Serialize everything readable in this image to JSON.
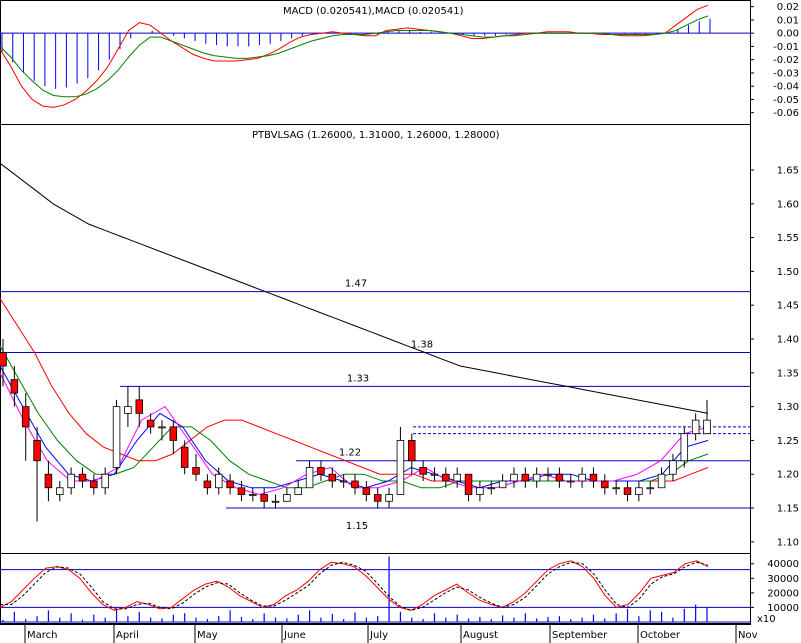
{
  "chart_data": [
    {
      "id": "macd",
      "type": "line",
      "title": "MACD (0.020541),MACD (0.020541)",
      "ylim": [
        -0.067,
        0.022
      ],
      "yticks": [
        "0.02",
        "0.01",
        "0.00",
        "-0.01",
        "-0.02",
        "-0.03",
        "-0.04",
        "-0.05",
        "-0.06"
      ],
      "ytick_values": [
        0.02,
        0.01,
        0.0,
        -0.01,
        -0.02,
        -0.03,
        -0.04,
        -0.05,
        -0.06
      ],
      "series": [
        {
          "color": "#ff0000",
          "values": [
            -0.012,
            -0.025,
            -0.04,
            -0.05,
            -0.055,
            -0.056,
            -0.054,
            -0.05,
            -0.044,
            -0.036,
            -0.026,
            -0.012,
            0.002,
            0.008,
            0.006,
            0.0,
            -0.006,
            -0.011,
            -0.016,
            -0.019,
            -0.021,
            -0.021,
            -0.021,
            -0.02,
            -0.019,
            -0.016,
            -0.012,
            -0.007,
            -0.003,
            -0.001,
            0.0,
            0.001,
            0.0,
            -0.001,
            -0.002,
            -0.002,
            0.002,
            0.003,
            0.004,
            0.003,
            0.002,
            0.001,
            0.0,
            -0.002,
            -0.004,
            -0.004,
            -0.003,
            -0.002,
            -0.001,
            0.0,
            0.0,
            0.001,
            0.001,
            0.001,
            0.0,
            0.0,
            -0.001,
            -0.001,
            -0.002,
            -0.002,
            -0.002,
            -0.001,
            0.0,
            0.006,
            0.012,
            0.018,
            0.021
          ]
        },
        {
          "color": "#008000",
          "values": [
            -0.01,
            -0.018,
            -0.028,
            -0.036,
            -0.043,
            -0.047,
            -0.048,
            -0.048,
            -0.046,
            -0.042,
            -0.036,
            -0.028,
            -0.018,
            -0.009,
            -0.003,
            -0.003,
            -0.006,
            -0.009,
            -0.012,
            -0.015,
            -0.017,
            -0.018,
            -0.019,
            -0.019,
            -0.018,
            -0.017,
            -0.015,
            -0.012,
            -0.009,
            -0.006,
            -0.004,
            -0.002,
            -0.001,
            -0.001,
            -0.001,
            0.0,
            0.001,
            0.002,
            0.002,
            0.002,
            0.002,
            0.001,
            0.0,
            -0.001,
            -0.002,
            -0.003,
            -0.003,
            -0.002,
            -0.002,
            -0.001,
            0.0,
            0.0,
            0.0,
            0.0,
            0.0,
            0.0,
            0.0,
            -0.001,
            -0.001,
            -0.001,
            -0.001,
            -0.001,
            0.0,
            0.002,
            0.006,
            0.01,
            0.013
          ]
        }
      ],
      "histogram": [
        -0.014,
        -0.022,
        -0.03,
        -0.036,
        -0.04,
        -0.042,
        -0.041,
        -0.038,
        -0.034,
        -0.028,
        -0.02,
        -0.012,
        -0.004,
        0.0,
        0.002,
        0.0,
        -0.002,
        -0.004,
        -0.006,
        -0.008,
        -0.009,
        -0.01,
        -0.01,
        -0.01,
        -0.009,
        -0.008,
        -0.006,
        -0.004,
        -0.002,
        -0.001,
        0.0,
        0.0,
        0.0,
        -0.001,
        -0.001,
        -0.001,
        0.001,
        0.002,
        0.002,
        0.001,
        0.001,
        0.0,
        0.0,
        -0.001,
        -0.002,
        -0.002,
        -0.002,
        -0.001,
        -0.001,
        0.0,
        0.0,
        0.0,
        0.0,
        0.0,
        0.0,
        0.0,
        0.0,
        0.0,
        -0.001,
        -0.001,
        -0.001,
        0.0,
        0.0,
        0.003,
        0.006,
        0.009,
        0.011
      ]
    },
    {
      "id": "price",
      "type": "candlestick",
      "title": "PTBVLSAG (1.26000, 1.31000, 1.26000, 1.28000)",
      "ylim": [
        1.085,
        1.715
      ],
      "yticks": [
        "1.65",
        "1.60",
        "1.55",
        "1.50",
        "1.45",
        "1.40",
        "1.35",
        "1.30",
        "1.25",
        "1.20",
        "1.15",
        "1.10"
      ],
      "ytick_values": [
        1.65,
        1.6,
        1.55,
        1.5,
        1.45,
        1.4,
        1.35,
        1.3,
        1.25,
        1.2,
        1.15,
        1.1
      ],
      "x_months": [
        "March",
        "April",
        "May",
        "June",
        "July",
        "August",
        "September",
        "October",
        "Nov"
      ],
      "candles": [
        [
          1.38,
          1.36,
          1.4,
          1.33
        ],
        [
          1.34,
          1.32,
          1.36,
          1.3
        ],
        [
          1.3,
          1.27,
          1.32,
          1.22
        ],
        [
          1.25,
          1.22,
          1.27,
          1.13
        ],
        [
          1.2,
          1.18,
          1.22,
          1.16
        ],
        [
          1.17,
          1.18,
          1.19,
          1.16
        ],
        [
          1.18,
          1.2,
          1.21,
          1.17
        ],
        [
          1.2,
          1.19,
          1.21,
          1.18
        ],
        [
          1.19,
          1.18,
          1.2,
          1.17
        ],
        [
          1.18,
          1.2,
          1.21,
          1.17
        ],
        [
          1.21,
          1.3,
          1.31,
          1.2
        ],
        [
          1.29,
          1.3,
          1.33,
          1.27
        ],
        [
          1.31,
          1.29,
          1.33,
          1.27
        ],
        [
          1.28,
          1.27,
          1.29,
          1.26
        ],
        [
          1.27,
          1.27,
          1.28,
          1.25
        ],
        [
          1.27,
          1.25,
          1.28,
          1.23
        ],
        [
          1.24,
          1.21,
          1.25,
          1.2
        ],
        [
          1.21,
          1.2,
          1.23,
          1.19
        ],
        [
          1.19,
          1.18,
          1.2,
          1.17
        ],
        [
          1.18,
          1.2,
          1.21,
          1.17
        ],
        [
          1.19,
          1.18,
          1.2,
          1.17
        ],
        [
          1.18,
          1.17,
          1.19,
          1.16
        ],
        [
          1.17,
          1.17,
          1.18,
          1.16
        ],
        [
          1.17,
          1.16,
          1.18,
          1.15
        ],
        [
          1.16,
          1.16,
          1.17,
          1.15
        ],
        [
          1.16,
          1.17,
          1.18,
          1.16
        ],
        [
          1.17,
          1.18,
          1.19,
          1.17
        ],
        [
          1.18,
          1.21,
          1.22,
          1.18
        ],
        [
          1.21,
          1.2,
          1.22,
          1.19
        ],
        [
          1.2,
          1.19,
          1.21,
          1.18
        ],
        [
          1.19,
          1.19,
          1.2,
          1.18
        ],
        [
          1.19,
          1.18,
          1.2,
          1.17
        ],
        [
          1.18,
          1.17,
          1.19,
          1.16
        ],
        [
          1.17,
          1.16,
          1.18,
          1.15
        ],
        [
          1.16,
          1.17,
          1.18,
          1.15
        ],
        [
          1.17,
          1.25,
          1.27,
          1.17
        ],
        [
          1.25,
          1.22,
          1.26,
          1.2
        ],
        [
          1.21,
          1.2,
          1.22,
          1.19
        ],
        [
          1.2,
          1.2,
          1.21,
          1.19
        ],
        [
          1.2,
          1.19,
          1.21,
          1.18
        ],
        [
          1.19,
          1.2,
          1.21,
          1.18
        ],
        [
          1.2,
          1.17,
          1.2,
          1.16
        ],
        [
          1.17,
          1.18,
          1.19,
          1.16
        ],
        [
          1.18,
          1.18,
          1.19,
          1.17
        ],
        [
          1.18,
          1.19,
          1.2,
          1.18
        ],
        [
          1.19,
          1.2,
          1.21,
          1.18
        ],
        [
          1.2,
          1.19,
          1.21,
          1.18
        ],
        [
          1.19,
          1.2,
          1.21,
          1.18
        ],
        [
          1.2,
          1.2,
          1.21,
          1.19
        ],
        [
          1.2,
          1.19,
          1.21,
          1.18
        ],
        [
          1.19,
          1.19,
          1.2,
          1.18
        ],
        [
          1.19,
          1.2,
          1.21,
          1.18
        ],
        [
          1.2,
          1.19,
          1.21,
          1.18
        ],
        [
          1.19,
          1.18,
          1.2,
          1.17
        ],
        [
          1.18,
          1.18,
          1.19,
          1.17
        ],
        [
          1.18,
          1.17,
          1.19,
          1.16
        ],
        [
          1.17,
          1.18,
          1.19,
          1.16
        ],
        [
          1.18,
          1.18,
          1.19,
          1.17
        ],
        [
          1.18,
          1.2,
          1.21,
          1.18
        ],
        [
          1.2,
          1.22,
          1.23,
          1.19
        ],
        [
          1.22,
          1.26,
          1.27,
          1.21
        ],
        [
          1.26,
          1.28,
          1.29,
          1.25
        ],
        [
          1.26,
          1.28,
          1.31,
          1.26
        ]
      ],
      "series": [
        {
          "color": "#000000",
          "values": [
            1.66,
            1.64,
            1.62,
            1.6,
            1.585,
            1.57,
            1.56,
            1.55,
            1.54,
            1.53,
            1.52,
            1.51,
            1.5,
            1.49,
            1.48,
            1.47,
            1.46,
            1.45,
            1.44,
            1.43,
            1.42,
            1.41,
            1.4,
            1.39,
            1.38,
            1.37,
            1.36,
            1.355,
            1.35,
            1.345,
            1.34,
            1.335,
            1.33,
            1.325,
            1.32,
            1.315,
            1.31,
            1.305,
            1.3,
            1.295,
            1.29
          ]
        },
        {
          "color": "#ff0000",
          "values": [
            1.46,
            1.42,
            1.38,
            1.33,
            1.29,
            1.26,
            1.24,
            1.23,
            1.22,
            1.22,
            1.23,
            1.25,
            1.27,
            1.28,
            1.28,
            1.27,
            1.26,
            1.25,
            1.24,
            1.23,
            1.22,
            1.21,
            1.2,
            1.2,
            1.2,
            1.19,
            1.19,
            1.19,
            1.19,
            1.19,
            1.19,
            1.19,
            1.19,
            1.19,
            1.19,
            1.19,
            1.19,
            1.19,
            1.19,
            1.19,
            1.2,
            1.21
          ]
        },
        {
          "color": "#008000",
          "values": [
            1.39,
            1.34,
            1.29,
            1.25,
            1.22,
            1.2,
            1.2,
            1.21,
            1.24,
            1.27,
            1.27,
            1.25,
            1.22,
            1.2,
            1.19,
            1.18,
            1.18,
            1.19,
            1.2,
            1.2,
            1.19,
            1.19,
            1.18,
            1.18,
            1.19,
            1.19,
            1.19,
            1.19,
            1.19,
            1.19,
            1.19,
            1.19,
            1.19,
            1.19,
            1.19,
            1.2,
            1.22,
            1.23
          ]
        },
        {
          "color": "#0000ff",
          "values": [
            1.36,
            1.3,
            1.24,
            1.2,
            1.19,
            1.2,
            1.25,
            1.29,
            1.27,
            1.22,
            1.19,
            1.18,
            1.18,
            1.19,
            1.2,
            1.19,
            1.18,
            1.19,
            1.21,
            1.2,
            1.19,
            1.18,
            1.19,
            1.19,
            1.2,
            1.2,
            1.19,
            1.19,
            1.19,
            1.2,
            1.24,
            1.25
          ]
        },
        {
          "color": "#ff00ff",
          "values": [
            1.35,
            1.28,
            1.22,
            1.19,
            1.19,
            1.21,
            1.28,
            1.3,
            1.25,
            1.2,
            1.18,
            1.17,
            1.18,
            1.2,
            1.21,
            1.18,
            1.18,
            1.19,
            1.21,
            1.19,
            1.18,
            1.18,
            1.19,
            1.2,
            1.19,
            1.19,
            1.19,
            1.2,
            1.22,
            1.26,
            1.27
          ]
        }
      ],
      "horizontal_levels": [
        {
          "value": 1.47,
          "label": "1.47"
        },
        {
          "value": 1.38,
          "label": "1.38"
        },
        {
          "value": 1.33,
          "label": "1.33"
        },
        {
          "value": 1.22,
          "label": "1.22"
        },
        {
          "value": 1.15,
          "label": "1.15"
        }
      ]
    },
    {
      "id": "volume",
      "type": "bar",
      "ylim": [
        0,
        46000
      ],
      "yticks": [
        "40000",
        "30000",
        "20000",
        "10000"
      ],
      "ytick_values": [
        40000,
        30000,
        20000,
        10000
      ],
      "y_unit_label": "x10",
      "volumes": [
        1500,
        7000,
        2000,
        4000,
        8000,
        3000,
        6000,
        1500,
        5000,
        3000,
        9000,
        4000,
        7000,
        3000,
        2500,
        5000,
        6000,
        3000,
        2000,
        4000,
        8000,
        3500,
        2000,
        6000,
        3000,
        2500,
        5000,
        8000,
        3000,
        5500,
        2000,
        6500,
        3000,
        4000,
        45000,
        7000,
        3000,
        2000,
        6000,
        3000,
        5000,
        2500,
        3500,
        2000,
        4500,
        3000,
        6000,
        2500,
        3500,
        4000,
        2000,
        3000,
        5000,
        2500,
        6000,
        9000,
        4000,
        8000,
        7000,
        3000,
        9000,
        12000,
        10000
      ],
      "lines": [
        {
          "color": "#ff0000",
          "values": [
            10000,
            14000,
            22000,
            30000,
            37000,
            38000,
            36000,
            30000,
            20000,
            12000,
            8000,
            10000,
            14000,
            12000,
            9000,
            10000,
            16000,
            22000,
            26000,
            28000,
            24000,
            18000,
            14000,
            10000,
            12000,
            18000,
            22000,
            28000,
            36000,
            41000,
            40000,
            38000,
            32000,
            24000,
            16000,
            10000,
            8000,
            12000,
            18000,
            22000,
            26000,
            20000,
            15000,
            12000,
            10000,
            14000,
            20000,
            28000,
            36000,
            40000,
            42000,
            38000,
            30000,
            18000,
            10000,
            12000,
            20000,
            30000,
            32000,
            34000,
            40000,
            42000,
            38000
          ]
        },
        {
          "color": "#000000",
          "values": [
            12000,
            12000,
            18000,
            26000,
            34000,
            38000,
            37000,
            33000,
            24000,
            14000,
            9000,
            9000,
            12000,
            13000,
            10000,
            9000,
            13000,
            19000,
            24000,
            27000,
            26000,
            20000,
            15000,
            11000,
            11000,
            15000,
            20000,
            25000,
            33000,
            39000,
            41000,
            39000,
            35000,
            27000,
            18000,
            11000,
            8000,
            10000,
            15000,
            20000,
            24000,
            22000,
            17000,
            13000,
            10000,
            12000,
            17000,
            25000,
            33000,
            38000,
            41000,
            40000,
            33000,
            22000,
            12000,
            10000,
            16000,
            26000,
            31000,
            33000,
            38000,
            41000,
            39000
          ]
        }
      ],
      "horizontal_levels": [
        36000,
        0
      ]
    }
  ]
}
